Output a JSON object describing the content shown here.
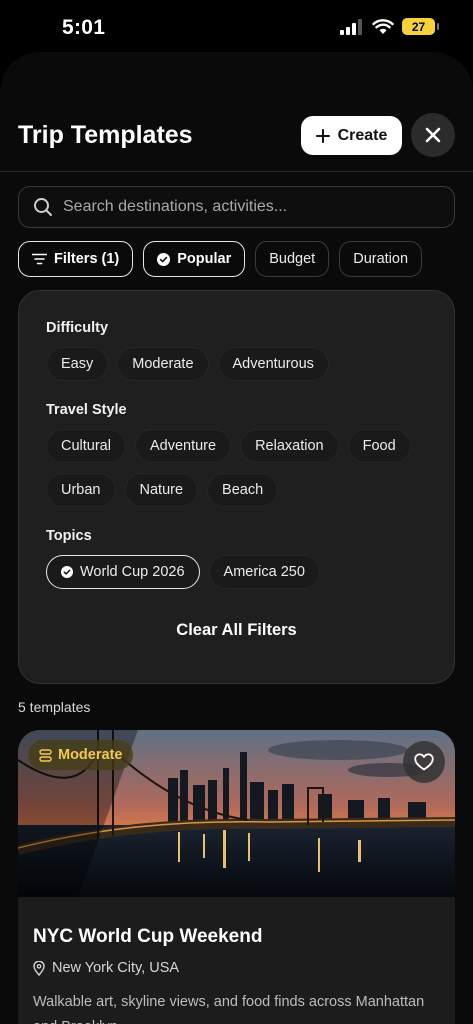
{
  "status_bar": {
    "time": "5:01",
    "battery": "27"
  },
  "header": {
    "title": "Trip Templates",
    "create_label": "Create"
  },
  "search": {
    "placeholder": "Search destinations, activities..."
  },
  "chips": [
    {
      "label": "Filters (1)",
      "icon": "filter-lines-icon",
      "active": true
    },
    {
      "label": "Popular",
      "icon": "check-circle-icon",
      "active": true
    },
    {
      "label": "Budget",
      "active": false
    },
    {
      "label": "Duration",
      "active": false
    }
  ],
  "filters": {
    "difficulty": {
      "label": "Difficulty",
      "options": [
        "Easy",
        "Moderate",
        "Adventurous"
      ]
    },
    "travel_style": {
      "label": "Travel Style",
      "options": [
        "Cultural",
        "Adventure",
        "Relaxation",
        "Food",
        "Urban",
        "Nature",
        "Beach"
      ]
    },
    "topics": {
      "label": "Topics",
      "options": [
        "World Cup 2026",
        "America 250"
      ],
      "selected": "World Cup 2026"
    },
    "clear_label": "Clear All Filters"
  },
  "results": {
    "count_text": "5 templates"
  },
  "card": {
    "badge": "Moderate",
    "title": "NYC World Cup Weekend",
    "location": "New York City, USA",
    "description": "Walkable art, skyline views, and food finds across Manhattan and Brooklyn."
  },
  "colors": {
    "accent_badge": "#f2c94c",
    "background": "#000000",
    "panel": "#1f1f1f"
  }
}
